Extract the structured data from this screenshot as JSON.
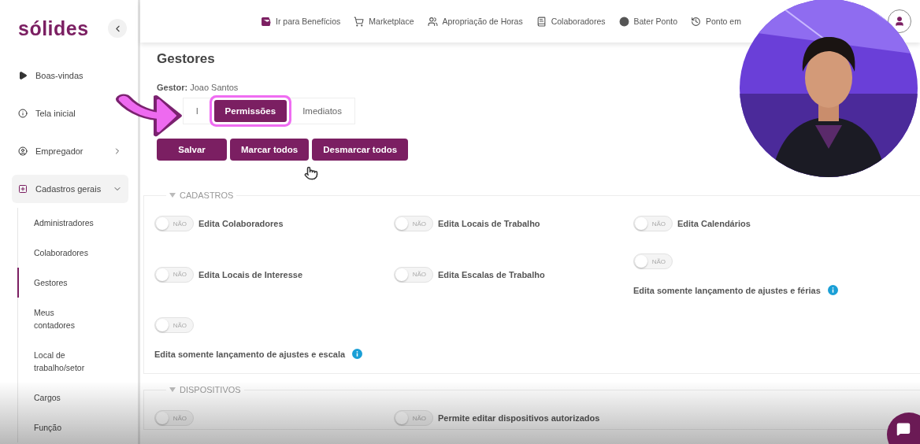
{
  "sidebar": {
    "logo": "sólides",
    "items": [
      {
        "label": "Boas-vindas",
        "kind": "link"
      },
      {
        "label": "Tela inicial",
        "kind": "link"
      },
      {
        "label": "Empregador",
        "kind": "group",
        "expanded": false
      },
      {
        "label": "Cadastros gerais",
        "kind": "group",
        "expanded": true,
        "children": [
          {
            "label": "Administradores",
            "selected": false
          },
          {
            "label": "Colaboradores",
            "selected": false
          },
          {
            "label": "Gestores",
            "selected": true
          },
          {
            "label": "Meus\ncontadores",
            "selected": false
          },
          {
            "label": "Local de\ntrabalho/setor",
            "selected": false
          },
          {
            "label": "Cargos",
            "selected": false
          },
          {
            "label": "Função",
            "selected": false
          }
        ]
      }
    ]
  },
  "top_nav": [
    {
      "label": "Ir para Benefícios"
    },
    {
      "label": "Marketplace"
    },
    {
      "label": "Apropriação de Horas"
    },
    {
      "label": "Colaboradores"
    },
    {
      "label": "Bater Ponto"
    },
    {
      "label": "Ponto em"
    }
  ],
  "page": {
    "title": "Gestores",
    "subtitle": "**Gestor:** Joao Santos",
    "tabs": [
      {
        "label": "l",
        "selected": false
      },
      {
        "label": "Permissões",
        "selected": true
      },
      {
        "label": "Imediatos",
        "selected": false
      }
    ],
    "buttons": [
      "Salvar",
      "Marcar todos",
      "Desmarcar todos"
    ],
    "sections": [
      {
        "title": "CADASTROS",
        "expanded": true,
        "permissions": [
          {
            "label": "Edita Colaboradores",
            "kind": "inline",
            "on": false,
            "state_label": "NÃO"
          },
          {
            "label": "Edita Locais de Trabalho",
            "kind": "inline",
            "on": false,
            "state_label": "NÃO"
          },
          {
            "label": "Edita Calendários",
            "kind": "inline",
            "on": false,
            "state_label": "NÃO"
          },
          {
            "label": "Edita Locais de Interesse",
            "kind": "inline",
            "on": false,
            "state_label": "NÃO"
          },
          {
            "label": "Edita Escalas de Trabalho",
            "kind": "inline",
            "on": false,
            "state_label": "NÃO"
          },
          {
            "label": "Edita somente lançamento de ajustes e férias",
            "kind": "stacked",
            "on": false,
            "state_label": "NÃO"
          },
          {
            "label": "Edita somente lançamento de ajustes e escala",
            "kind": "stacked",
            "on": false,
            "state_label": "NÃO"
          }
        ]
      },
      {
        "title": "DISPOSITIVOS",
        "expanded": true,
        "permissions": [
          {
            "kind": "stacked",
            "on": false,
            "state_label": "NÃO"
          },
          {
            "label": "Permite editar dispositivos autorizados",
            "kind": "inline",
            "on": false,
            "state_label": "NÃO"
          }
        ]
      }
    ]
  }
}
